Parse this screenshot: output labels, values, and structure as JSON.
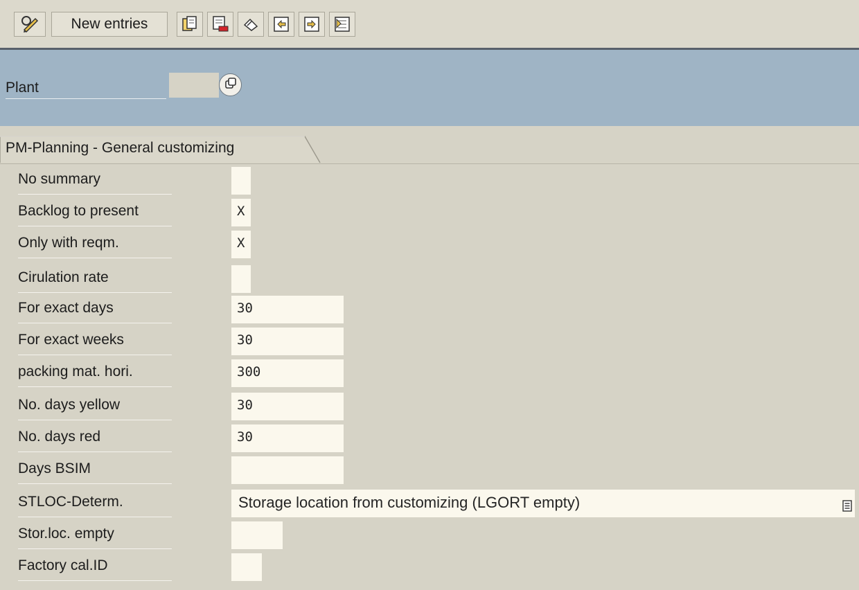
{
  "toolbar": {
    "new_entries_label": "New entries",
    "icons": [
      "display-change-icon",
      "copy-icon",
      "delete-icon",
      "undo-icon",
      "select-all-icon",
      "select-block-icon",
      "deselect-all-icon"
    ]
  },
  "header": {
    "plant_label": "Plant",
    "plant_value": ""
  },
  "tab": {
    "label": "PM-Planning - General customizing"
  },
  "form": {
    "rows": [
      {
        "label": "No summary",
        "value": ""
      },
      {
        "label": "Backlog to present",
        "value": "X"
      },
      {
        "label": "Only with reqm.",
        "value": "X"
      },
      {
        "label": "Cirulation rate",
        "value": ""
      },
      {
        "label": "For exact days",
        "value": "30"
      },
      {
        "label": "For exact weeks",
        "value": "30"
      },
      {
        "label": "packing mat. hori.",
        "value": "300"
      },
      {
        "label": "No. days yellow",
        "value": "30"
      },
      {
        "label": "No. days red",
        "value": "30"
      },
      {
        "label": "Days BSIM",
        "value": ""
      },
      {
        "label": "STLOC-Determ.",
        "value": "Storage location from customizing (LGORT empty)"
      },
      {
        "label": "Stor.loc. empty",
        "value": ""
      },
      {
        "label": "Factory cal.ID",
        "value": ""
      }
    ]
  },
  "colors": {
    "header_bg": "#9fb4c5",
    "body_bg": "#d6d3c6",
    "field_bg": "#fbf8ed"
  }
}
